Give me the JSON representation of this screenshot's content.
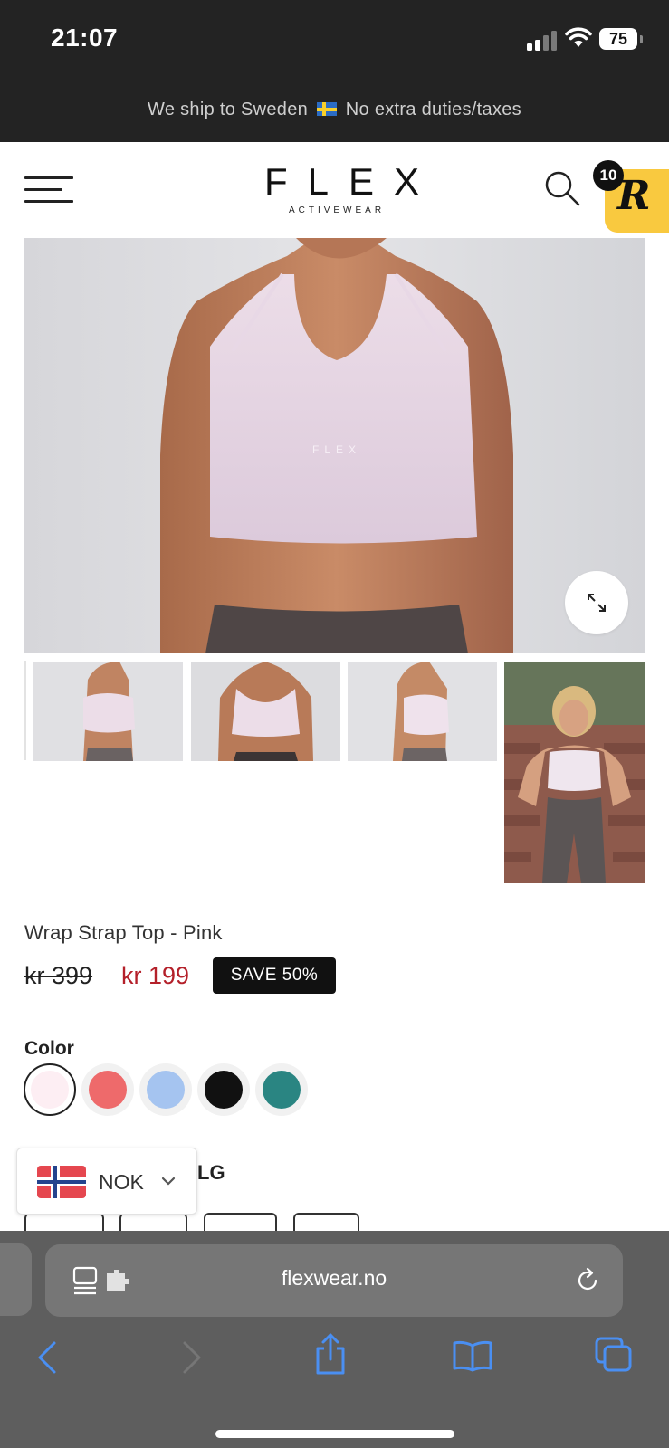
{
  "status_bar": {
    "time": "21:07",
    "battery": "75"
  },
  "shipping_banner": {
    "text_before_flag": "We ship to Sweden",
    "text_after_flag": "No extra duties/taxes",
    "flag_icon": "sweden-flag-icon"
  },
  "header": {
    "menu_icon": "hamburger-menu-icon",
    "logo_main": "FLEX",
    "logo_sub": "ACTIVEWEAR",
    "search_icon": "search-icon",
    "cart_count": "10",
    "reward_badge": "R"
  },
  "gallery": {
    "expand_icon": "expand-icon",
    "thumbnails": [
      "side-view",
      "front-view",
      "side-view-2",
      "full-body-view"
    ]
  },
  "product": {
    "title": "Wrap Strap Top - Pink",
    "price_original": "kr 399",
    "price_sale": "kr 199",
    "save_badge": "SAVE 50%",
    "sale_color": "#b4202a"
  },
  "color_selector": {
    "label": "Color",
    "swatches": [
      {
        "name": "pink",
        "hex": "#fdeef3",
        "selected": true
      },
      {
        "name": "coral",
        "hex": "#ee6a6b",
        "selected": false
      },
      {
        "name": "light-blue",
        "hex": "#a5c4f0",
        "selected": false
      },
      {
        "name": "black",
        "hex": "#111111",
        "selected": false
      },
      {
        "name": "teal",
        "hex": "#2a8582",
        "selected": false
      }
    ]
  },
  "size_selector": {
    "label_visible": "LG"
  },
  "currency_selector": {
    "code": "NOK",
    "flag_icon": "norway-flag-icon"
  },
  "browser": {
    "url": "flexwear.no",
    "page_icon": "page-menu-icon",
    "reload_icon": "reload-icon",
    "toolbar": [
      "back-icon",
      "forward-icon",
      "share-icon",
      "bookmarks-icon",
      "tabs-icon"
    ]
  }
}
